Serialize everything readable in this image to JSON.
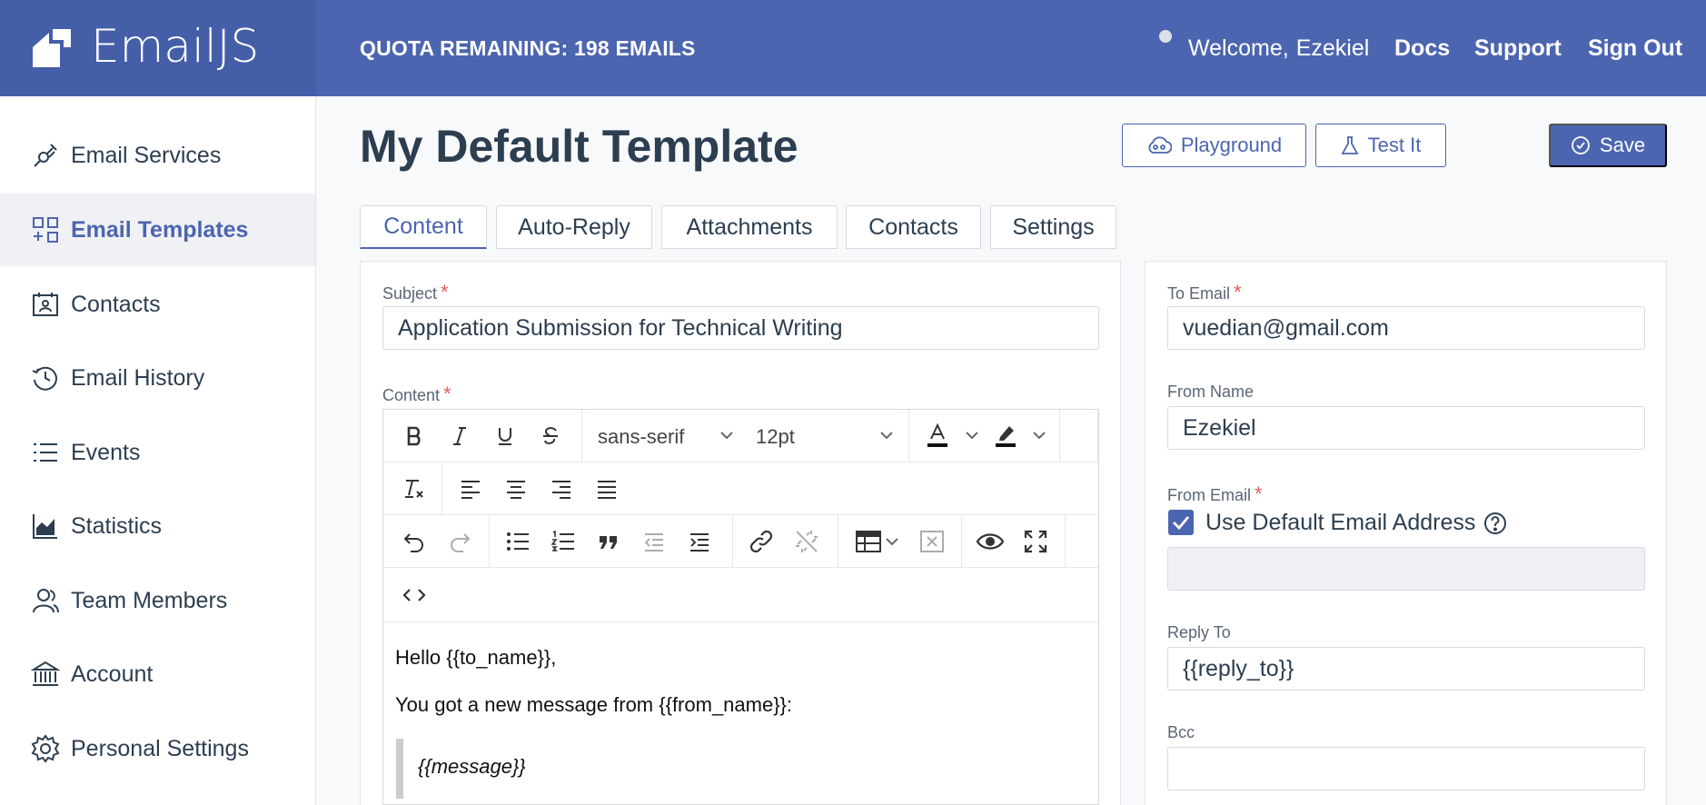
{
  "app": {
    "logo_text": "EmailJS",
    "quota": "QUOTA REMAINING: 198 EMAILS",
    "welcome": "Welcome,",
    "user_name": "Ezekiel",
    "nav": {
      "docs": "Docs",
      "support": "Support",
      "sign_out": "Sign Out"
    }
  },
  "sidebar": {
    "items": [
      {
        "label": "Email Services",
        "icon": "plug-icon",
        "active": false
      },
      {
        "label": "Email Templates",
        "icon": "templates-icon",
        "active": true
      },
      {
        "label": "Contacts",
        "icon": "contacts-icon",
        "active": false
      },
      {
        "label": "Email History",
        "icon": "history-icon",
        "active": false
      },
      {
        "label": "Events",
        "icon": "list-icon",
        "active": false
      },
      {
        "label": "Statistics",
        "icon": "chart-icon",
        "active": false
      },
      {
        "label": "Team Members",
        "icon": "team-icon",
        "active": false
      },
      {
        "label": "Account",
        "icon": "bank-icon",
        "active": false
      },
      {
        "label": "Personal Settings",
        "icon": "gear-icon",
        "active": false
      }
    ]
  },
  "header": {
    "title": "My Default Template",
    "playground": "Playground",
    "test_it": "Test It",
    "save": "Save"
  },
  "tabs": [
    {
      "label": "Content",
      "active": true
    },
    {
      "label": "Auto-Reply",
      "active": false
    },
    {
      "label": "Attachments",
      "active": false
    },
    {
      "label": "Contacts",
      "active": false
    },
    {
      "label": "Settings",
      "active": false
    }
  ],
  "content_form": {
    "subject_label": "Subject",
    "subject_value": "Application Submission for Technical Writing",
    "content_label": "Content",
    "font_family": "sans-serif",
    "font_size": "12pt",
    "body_lines": {
      "greeting": "Hello {{to_name}},",
      "intro": "You got a new message from {{from_name}}:",
      "quote": "{{message}}"
    }
  },
  "side_form": {
    "to_email_label": "To Email",
    "to_email_value": "vuedian@gmail.com",
    "from_name_label": "From Name",
    "from_name_value": "Ezekiel",
    "from_email_label": "From Email",
    "use_default_label": "Use Default Email Address",
    "use_default_checked": true,
    "from_email_value": "",
    "reply_to_label": "Reply To",
    "reply_to_value": "{{reply_to}}",
    "bcc_label": "Bcc",
    "bcc_value": ""
  },
  "colors": {
    "brand": "#4c65b0",
    "required": "#e25b5b"
  }
}
